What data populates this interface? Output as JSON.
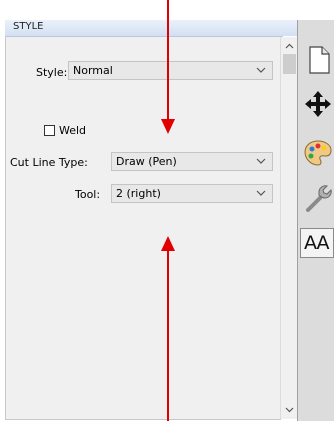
{
  "panel": {
    "title": "STYLE"
  },
  "style_row": {
    "label": "Style:",
    "value": "Normal"
  },
  "weld": {
    "label": "Weld",
    "checked": false
  },
  "cut_line_row": {
    "label": "Cut Line Type:",
    "value": "Draw (Pen)"
  },
  "tool_row": {
    "label": "Tool:",
    "value": "2 (right)"
  },
  "side_toolbar": {
    "icons": [
      "page-icon",
      "move-icon",
      "palette-icon",
      "wrench-icon",
      "text-size-icon"
    ],
    "text_icon_label": "AA"
  },
  "annotations": {
    "arrow_color": "#e00000"
  }
}
